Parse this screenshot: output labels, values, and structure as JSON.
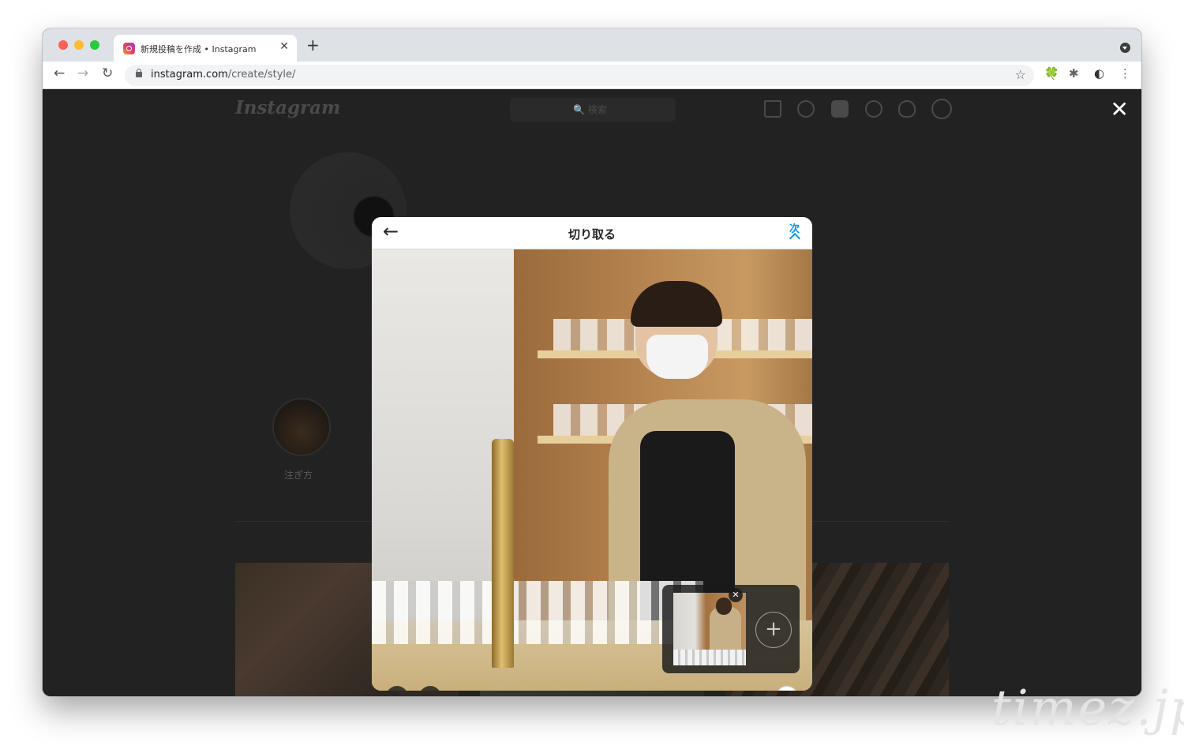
{
  "browser": {
    "tab_title": "新規投稿を作成 • Instagram",
    "tab_close": "✕",
    "new_tab": "+",
    "url_host": "instagram.com",
    "url_path": "/create/style/",
    "nav": {
      "back": "←",
      "forward": "→",
      "reload": "↻",
      "star": "☆"
    },
    "extensions": [
      "🍀",
      "✱",
      "◐",
      "⋮"
    ]
  },
  "instagram": {
    "logo": "Instagram",
    "search_placeholder": "🔍 検索",
    "nav_icons": [
      "home-icon",
      "messenger-icon",
      "new-post-icon",
      "explore-icon",
      "heart-icon",
      "profile-icon"
    ],
    "close": "✕",
    "highlight_label": "注ぎ方"
  },
  "modal": {
    "back": "←",
    "title": "切り取る",
    "next": "次",
    "tools": {
      "expand": "⤢",
      "zoom": "⊕",
      "multi": "❐"
    },
    "carousel": {
      "remove": "✕",
      "add": "+"
    }
  },
  "watermark": "timez.jp",
  "colors": {
    "accent": "#0095f6",
    "overlay": "#222222"
  }
}
